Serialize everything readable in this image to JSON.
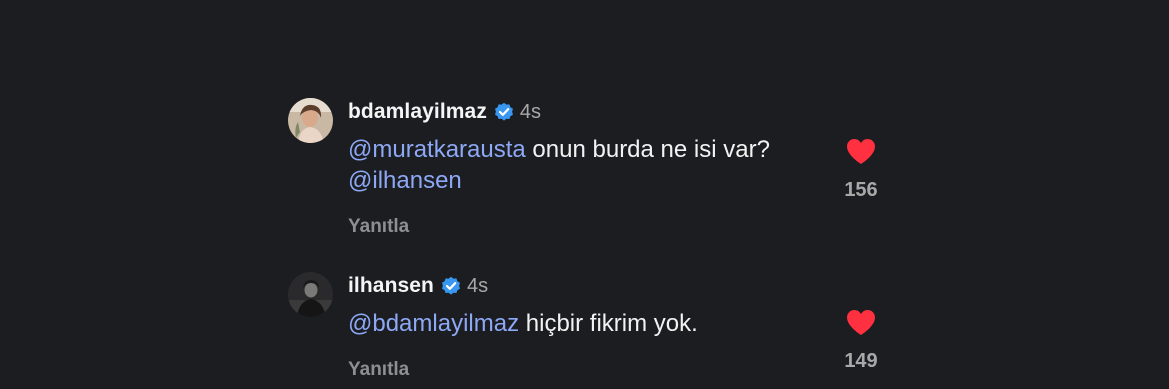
{
  "comments": [
    {
      "username": "bdamlayilmaz",
      "time": "4s",
      "mention1": "@muratkarausta",
      "text1": " onun burda ne isi var? ",
      "mention2": "@ilhansen",
      "reply": "Yanıtla",
      "likes": "156",
      "avatar_icon": "profile-photo-woman"
    },
    {
      "username": "ilhansen",
      "time": "4s",
      "mention1": "@bdamlayilmaz",
      "text1": " hiçbir fikrim yok.",
      "reply": "Yanıtla",
      "likes": "149",
      "avatar_icon": "profile-photo-man"
    }
  ],
  "colors": {
    "background": "#1c1d21",
    "mention": "#8da8f5",
    "verified": "#3897f0",
    "heart": "#ff3040",
    "muted": "#a8a8a8"
  }
}
